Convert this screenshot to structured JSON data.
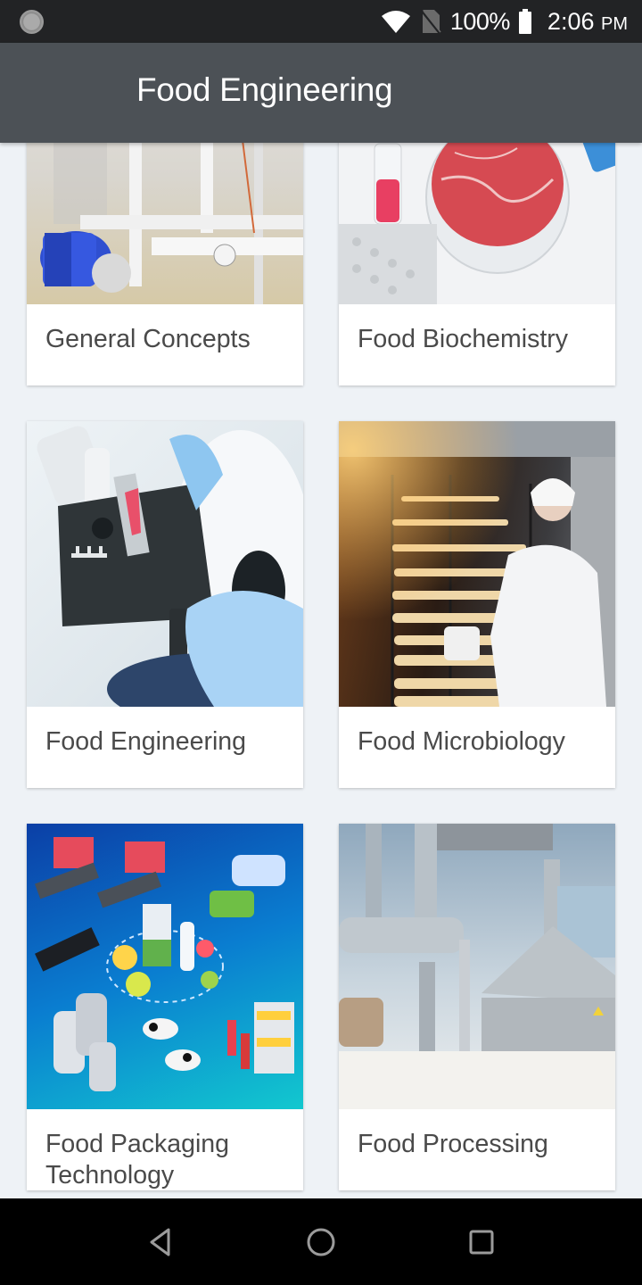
{
  "status_bar": {
    "battery_percent": "100%",
    "time": "2:06",
    "time_suffix": "PM",
    "icons": [
      "loading-spinner-icon",
      "wifi-icon",
      "no-sim-icon",
      "battery-full-icon"
    ]
  },
  "app_bar": {
    "title": "Food Engineering"
  },
  "cards": [
    {
      "label": "General Concepts",
      "image": "industrial-pump-pipes"
    },
    {
      "label": "Food Biochemistry",
      "image": "lab-meat-petri-dish"
    },
    {
      "label": "Food Engineering",
      "image": "microscope-meat-sample"
    },
    {
      "label": "Food Microbiology",
      "image": "baker-oven-rack"
    },
    {
      "label": "Food Packaging Technology",
      "image": "dairy-production-infographic"
    },
    {
      "label": "Food Processing",
      "image": "stainless-steel-tanks"
    }
  ],
  "nav_bar": {
    "buttons": [
      "back-icon",
      "home-icon",
      "recents-icon"
    ]
  }
}
